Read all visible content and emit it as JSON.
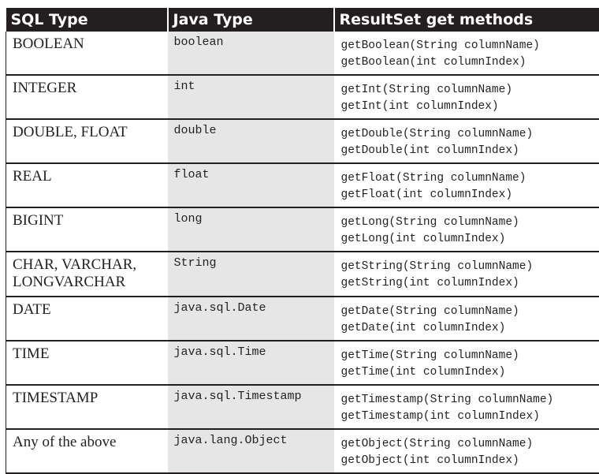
{
  "headers": {
    "sql_type": "SQL Type",
    "java_type": "Java Type",
    "methods": "ResultSet get methods"
  },
  "rows": [
    {
      "sql": "BOOLEAN",
      "java": "boolean",
      "m1": "getBoolean(String columnName)",
      "m2": "getBoolean(int columnIndex)"
    },
    {
      "sql": "INTEGER",
      "java": "int",
      "m1": "getInt(String columnName)",
      "m2": "getInt(int columnIndex)"
    },
    {
      "sql": "DOUBLE, FLOAT",
      "java": "double",
      "m1": "getDouble(String columnName)",
      "m2": "getDouble(int columnIndex)"
    },
    {
      "sql": "REAL",
      "java": "float",
      "m1": "getFloat(String columnName)",
      "m2": "getFloat(int columnIndex)"
    },
    {
      "sql": "BIGINT",
      "java": "long",
      "m1": "getLong(String columnName)",
      "m2": "getLong(int columnIndex)"
    },
    {
      "sql": "CHAR, VARCHAR, LONGVARCHAR",
      "java": "String",
      "m1": "getString(String columnName)",
      "m2": "getString(int columnIndex)"
    },
    {
      "sql": "DATE",
      "java": "java.sql.Date",
      "m1": "getDate(String columnName)",
      "m2": "getDate(int columnIndex)"
    },
    {
      "sql": "TIME",
      "java": "java.sql.Time",
      "m1": "getTime(String columnName)",
      "m2": "getTime(int columnIndex)"
    },
    {
      "sql": "TIMESTAMP",
      "java": "java.sql.Timestamp",
      "m1": "getTimestamp(String columnName)",
      "m2": "getTimestamp(int columnIndex)"
    },
    {
      "sql": "Any of the above",
      "java": "java.lang.Object",
      "m1": "getObject(String columnName)",
      "m2": "getObject(int columnIndex)"
    }
  ]
}
